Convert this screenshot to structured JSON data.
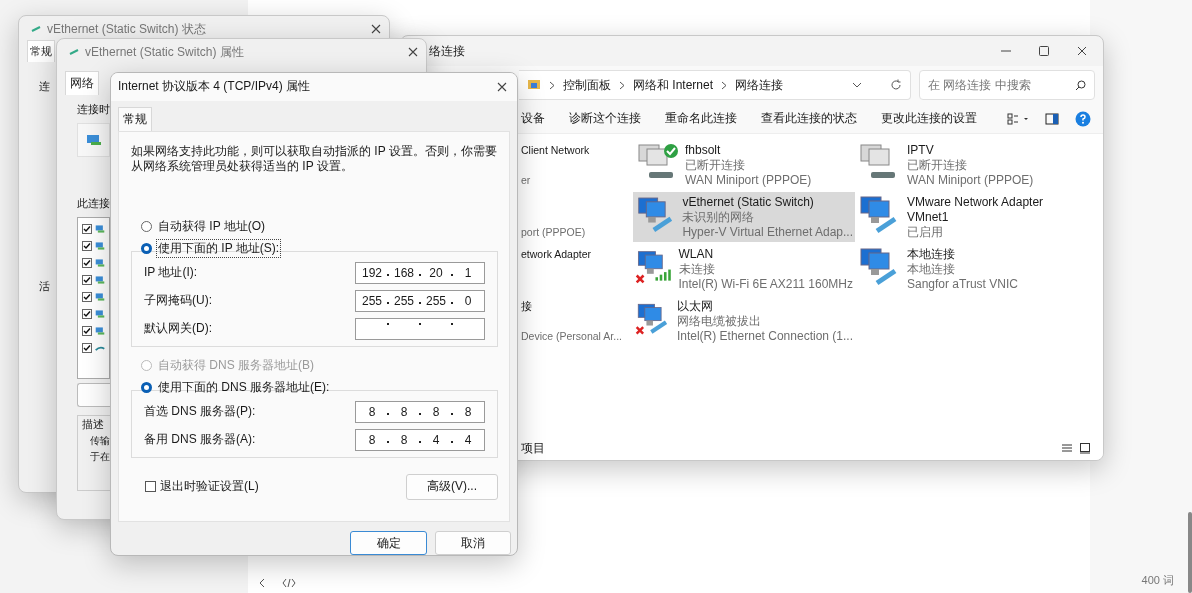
{
  "editor": {
    "word_count": "400 词"
  },
  "status_window": {
    "title": "vEthernet (Static Switch) 状态",
    "tab": {
      "label": "常规",
      "selected": true
    },
    "fragments": [
      "连",
      "活"
    ]
  },
  "properties_window": {
    "title": "vEthernet (Static Switch) 属性",
    "tab": {
      "label": "网络",
      "selected": true
    },
    "connect_label": "连接时",
    "items_label": "此连接",
    "components": [
      {
        "checked": true,
        "kind": "network"
      },
      {
        "checked": true,
        "kind": "network"
      },
      {
        "checked": true,
        "kind": "network"
      },
      {
        "checked": true,
        "kind": "network"
      },
      {
        "checked": true,
        "kind": "network"
      },
      {
        "checked": true,
        "kind": "network"
      },
      {
        "checked": true,
        "kind": "network"
      },
      {
        "checked": true,
        "kind": "protocol"
      }
    ],
    "description_label": "描述",
    "description": [
      "传输",
      "于在"
    ]
  },
  "explorer": {
    "title": "络连接",
    "breadcrumb": [
      "控制面板",
      "网络和 Internet",
      "网络连接"
    ],
    "search": {
      "placeholder": "在 网络连接 中搜索"
    },
    "commands": [
      "设备",
      "诊断这个连接",
      "重命名此连接",
      "查看此连接的状态",
      "更改此连接的设置"
    ],
    "cut_items": [
      {
        "name": "Client Network",
        "device": "er"
      },
      {
        "device": "port (PPPOE)"
      },
      {
        "name": "etwork Adapter"
      },
      {
        "name": "接",
        "device": "Device (Personal Ar..."
      }
    ],
    "items": [
      {
        "name": "fhbsolt",
        "status": "已断开连接",
        "device": "WAN Miniport (PPPOE)",
        "kind": "dialup",
        "connected": true,
        "error": false,
        "selected": false
      },
      {
        "name": "IPTV",
        "status": "已断开连接",
        "device": "WAN Miniport (PPPOE)",
        "kind": "dialup",
        "connected": false,
        "error": false,
        "selected": false
      },
      {
        "name": "vEthernet (Static Switch)",
        "status": "未识别的网络",
        "device": "Hyper-V Virtual Ethernet Adap...",
        "kind": "ethernet",
        "connected": false,
        "error": false,
        "selected": true
      },
      {
        "name": "VMware Network Adapter VMnet1",
        "status": "已启用",
        "kind": "ethernet",
        "connected": false,
        "error": false,
        "selected": false
      },
      {
        "name": "WLAN",
        "status": "未连接",
        "device": "Intel(R) Wi-Fi 6E AX211 160MHz",
        "kind": "wifi",
        "connected": false,
        "error": true,
        "selected": false
      },
      {
        "name": "本地连接",
        "status": "本地连接",
        "device": "Sangfor aTrust VNIC",
        "kind": "ethernet",
        "connected": false,
        "error": false,
        "selected": false
      },
      {
        "name": "以太网",
        "status": "网络电缆被拔出",
        "device": "Intel(R) Ethernet Connection (1...",
        "kind": "ethernet",
        "connected": false,
        "error": true,
        "selected": false
      }
    ],
    "status_bar": "项目"
  },
  "ipv4_dialog": {
    "title": "Internet 协议版本 4 (TCP/IPv4) 属性",
    "tab": {
      "label": "常规",
      "selected": true
    },
    "intro": "如果网络支持此功能，则可以获取自动指派的 IP 设置。否则，你需要从网络系统管理员处获得适当的 IP 设置。",
    "ip_modes": [
      {
        "label": "自动获得 IP 地址(O)",
        "selected": false,
        "disabled": false
      },
      {
        "label": "使用下面的 IP 地址(S):",
        "selected": true,
        "disabled": false
      }
    ],
    "ip_fields": [
      {
        "label": "IP 地址(I):",
        "octets": [
          "192",
          "168",
          "20",
          "1"
        ]
      },
      {
        "label": "子网掩码(U):",
        "octets": [
          "255",
          "255",
          "255",
          "0"
        ]
      },
      {
        "label": "默认网关(D):"
      }
    ],
    "dns_modes": [
      {
        "label": "自动获得 DNS 服务器地址(B)",
        "selected": false,
        "disabled": true
      },
      {
        "label": "使用下面的 DNS 服务器地址(E):",
        "selected": true,
        "disabled": false
      }
    ],
    "dns_fields": [
      {
        "label": "首选 DNS 服务器(P):",
        "octets": [
          "8",
          "8",
          "8",
          "8"
        ]
      },
      {
        "label": "备用 DNS 服务器(A):",
        "octets": [
          "8",
          "8",
          "4",
          "4"
        ]
      }
    ],
    "validate": {
      "label": "退出时验证设置(L)",
      "checked": false
    },
    "advanced": "高级(V)...",
    "ok": "确定",
    "cancel": "取消"
  }
}
